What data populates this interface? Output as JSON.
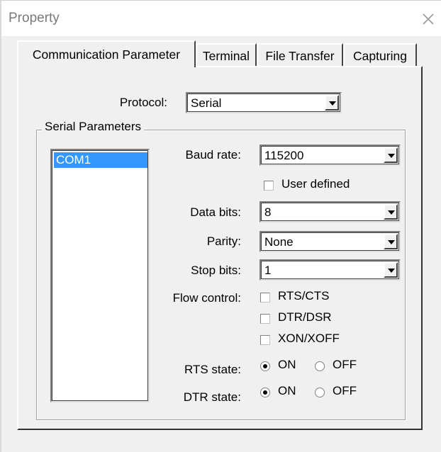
{
  "window": {
    "title": "Property",
    "close_icon": "close-icon"
  },
  "tabs": [
    {
      "label": "Communication Parameter",
      "active": true
    },
    {
      "label": "Terminal",
      "active": false
    },
    {
      "label": "File Transfer",
      "active": false
    },
    {
      "label": "Capturing",
      "active": false
    }
  ],
  "protocol": {
    "label": "Protocol:",
    "value": "Serial"
  },
  "serial": {
    "group_title": "Serial Parameters",
    "ports": [
      "COM1"
    ],
    "selected_port": "COM1",
    "baud_rate": {
      "label": "Baud rate:",
      "value": "115200"
    },
    "user_defined": {
      "label": "User defined",
      "checked": false
    },
    "data_bits": {
      "label": "Data bits:",
      "value": "8"
    },
    "parity": {
      "label": "Parity:",
      "value": "None"
    },
    "stop_bits": {
      "label": "Stop bits:",
      "value": "1"
    },
    "flow_control": {
      "label": "Flow control:",
      "options": [
        {
          "label": "RTS/CTS",
          "checked": false
        },
        {
          "label": "DTR/DSR",
          "checked": false
        },
        {
          "label": "XON/XOFF",
          "checked": false
        }
      ]
    },
    "rts_state": {
      "label": "RTS state:",
      "on_label": "ON",
      "off_label": "OFF",
      "value": "ON"
    },
    "dtr_state": {
      "label": "DTR state:",
      "on_label": "ON",
      "off_label": "OFF",
      "value": "ON"
    }
  },
  "colors": {
    "selection": "#3399ff",
    "face": "#f0f0f0",
    "title_text": "#7a7a7a"
  }
}
